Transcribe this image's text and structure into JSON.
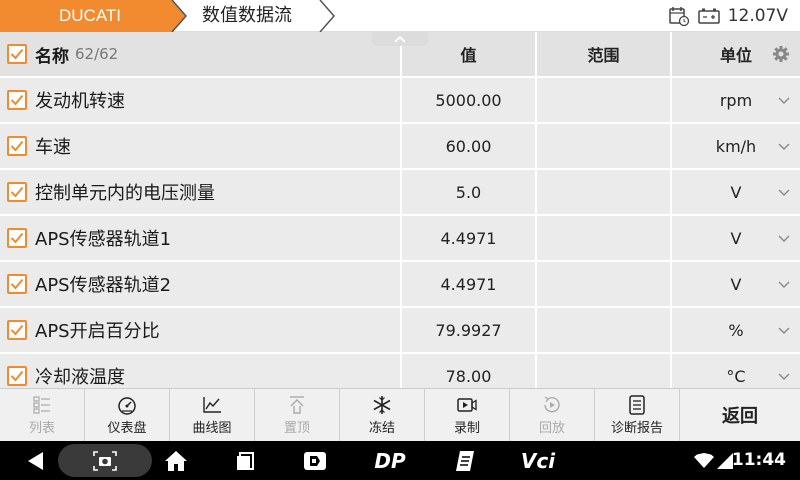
{
  "header": {
    "brand": "DUCATI",
    "breadcrumb": "数值数据流",
    "voltage": "12.07V"
  },
  "table": {
    "columns": {
      "name": "名称",
      "count": "62/62",
      "value": "值",
      "range": "范围",
      "unit": "单位"
    },
    "rows": [
      {
        "name": "发动机转速",
        "value": "5000.00",
        "range": "",
        "unit": "rpm"
      },
      {
        "name": "车速",
        "value": "60.00",
        "range": "",
        "unit": "km/h"
      },
      {
        "name": "控制单元内的电压测量",
        "value": "5.0",
        "range": "",
        "unit": "V"
      },
      {
        "name": "APS传感器轨道1",
        "value": "4.4971",
        "range": "",
        "unit": "V"
      },
      {
        "name": "APS传感器轨道2",
        "value": "4.4971",
        "range": "",
        "unit": "V"
      },
      {
        "name": "APS开启百分比",
        "value": "79.9927",
        "range": "",
        "unit": "%"
      },
      {
        "name": "冷却液温度",
        "value": "78.00",
        "range": "",
        "unit": "°C"
      }
    ]
  },
  "toolbar": {
    "list": "列表",
    "gauge": "仪表盘",
    "graph": "曲线图",
    "top": "置顶",
    "freeze": "冻结",
    "record": "录制",
    "playback": "回放",
    "report": "诊断报告",
    "back": "返回"
  },
  "navbar": {
    "time": "11:44",
    "dp_label": "DP",
    "vci_label": "Vci"
  },
  "colors": {
    "accent": "#f28a30",
    "grid_cell": "#ebebeb",
    "nav_bg": "#000000"
  }
}
